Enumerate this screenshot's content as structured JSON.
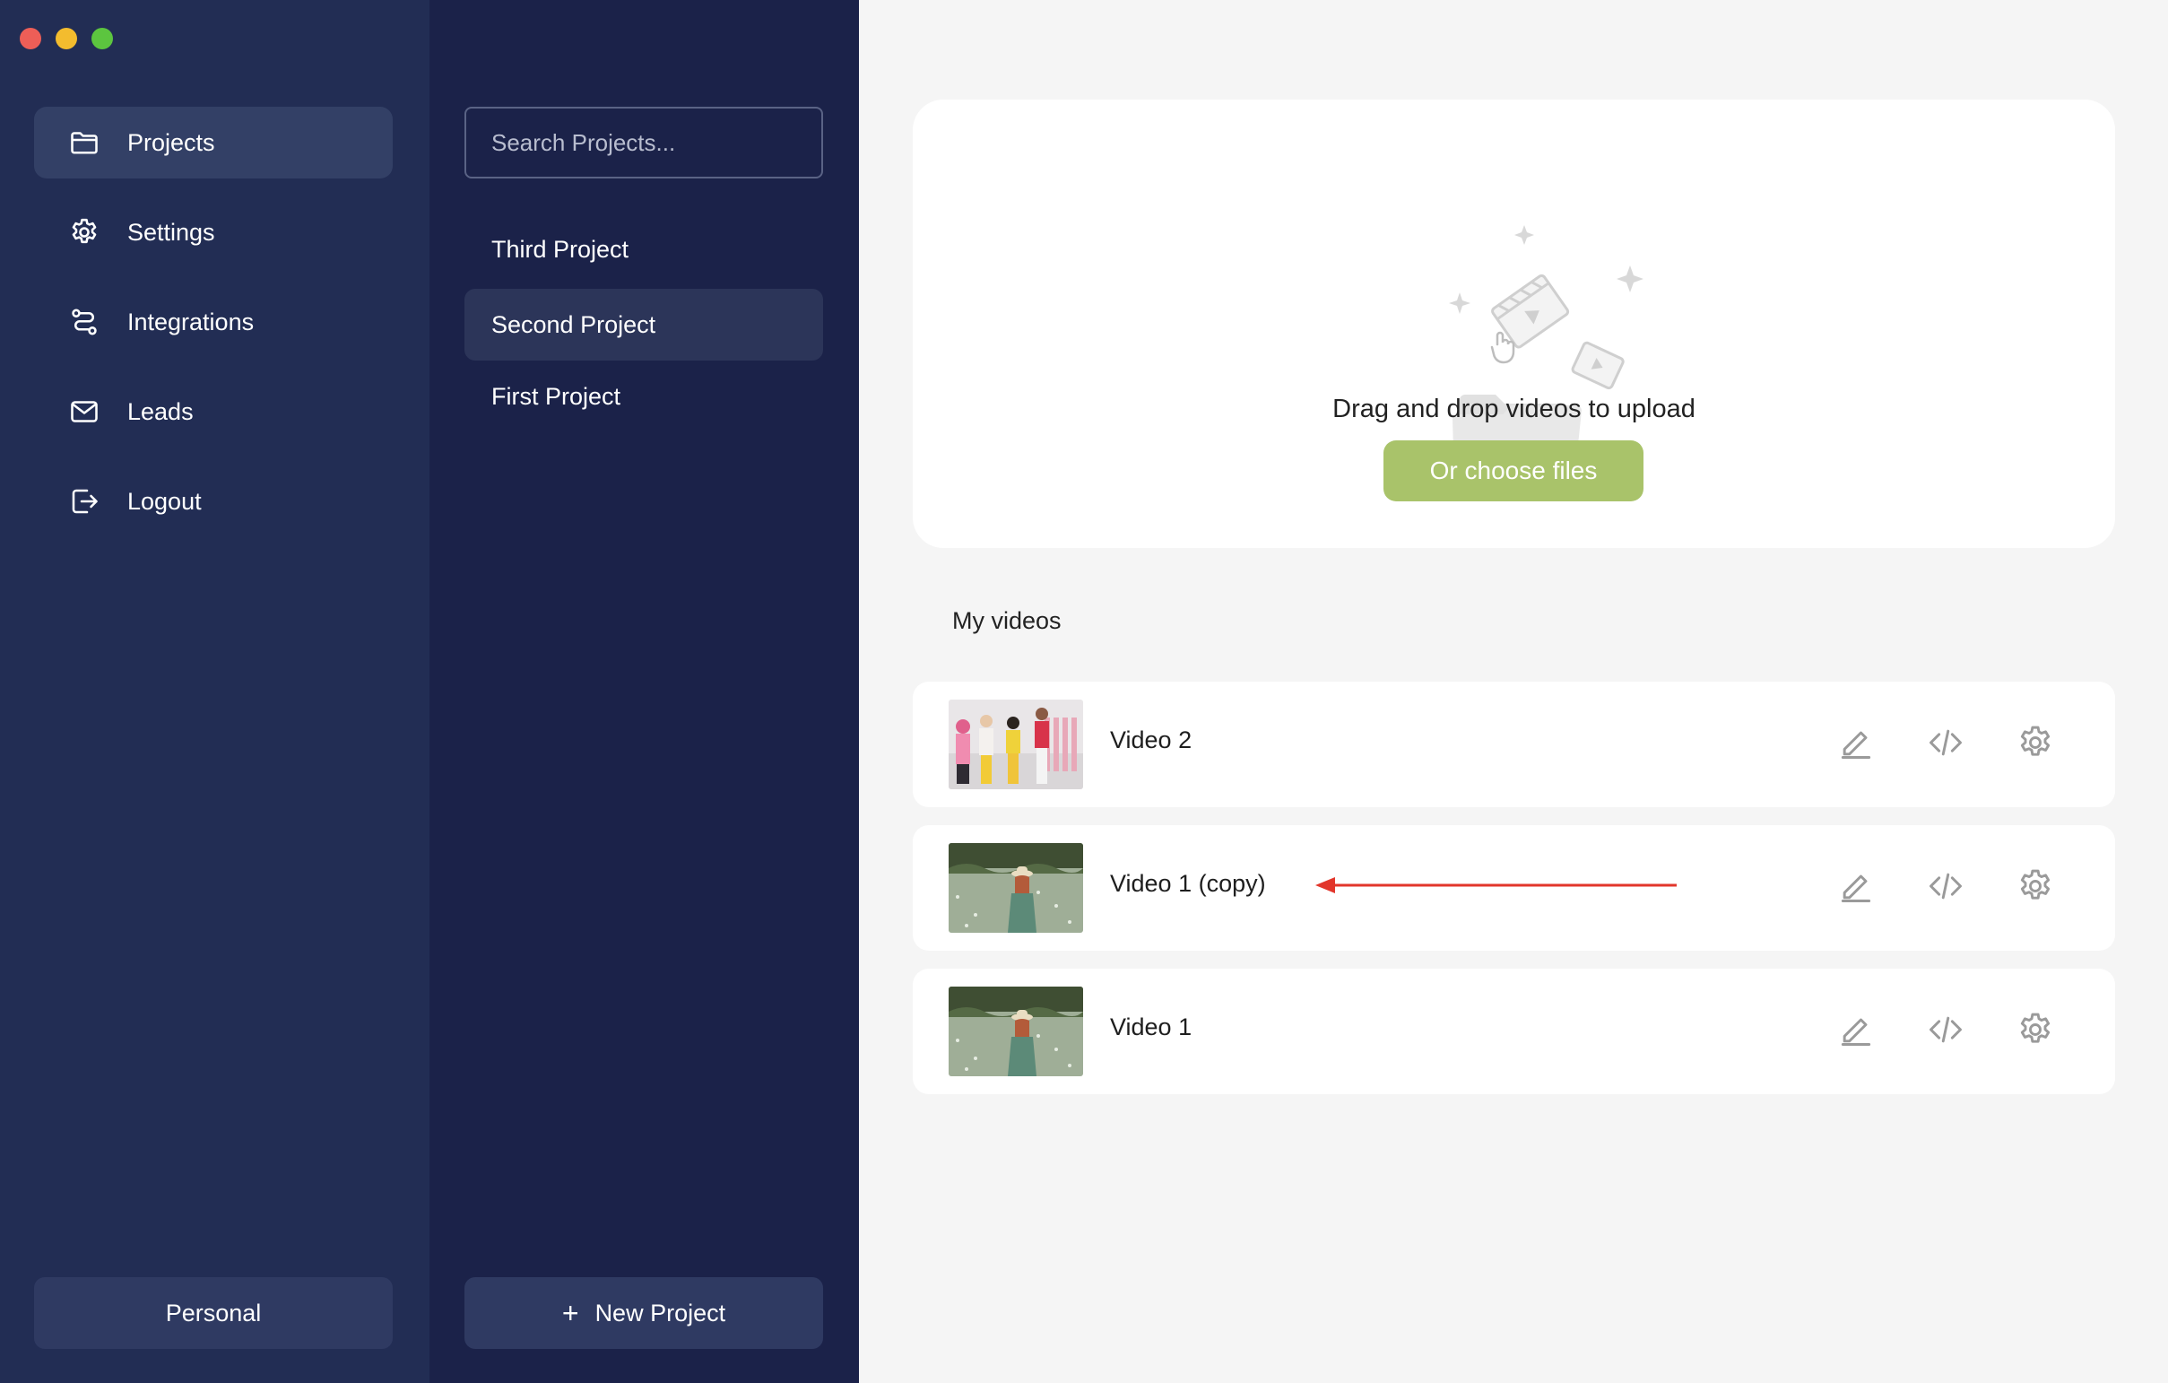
{
  "nav": {
    "items": [
      {
        "label": "Projects",
        "icon": "folder-icon",
        "active": true
      },
      {
        "label": "Settings",
        "icon": "gear-icon"
      },
      {
        "label": "Integrations",
        "icon": "route-icon"
      },
      {
        "label": "Leads",
        "icon": "mail-icon"
      },
      {
        "label": "Logout",
        "icon": "logout-icon"
      }
    ],
    "workspace_label": "Personal"
  },
  "projects": {
    "search_placeholder": "Search Projects...",
    "items": [
      {
        "label": "Third Project"
      },
      {
        "label": "Second Project",
        "active": true
      },
      {
        "label": "First Project"
      }
    ],
    "new_project_label": "New Project"
  },
  "upload": {
    "text": "Drag and drop videos to upload",
    "button_label": "Or choose files"
  },
  "videos": {
    "heading": "My videos",
    "items": [
      {
        "title": "Video 2"
      },
      {
        "title": "Video 1 (copy)"
      },
      {
        "title": "Video 1"
      }
    ]
  },
  "colors": {
    "nav_bg": "#222d54",
    "projects_bg": "#1b2249",
    "accent_green": "#a9c36a",
    "annotation_red": "#e2362b"
  }
}
